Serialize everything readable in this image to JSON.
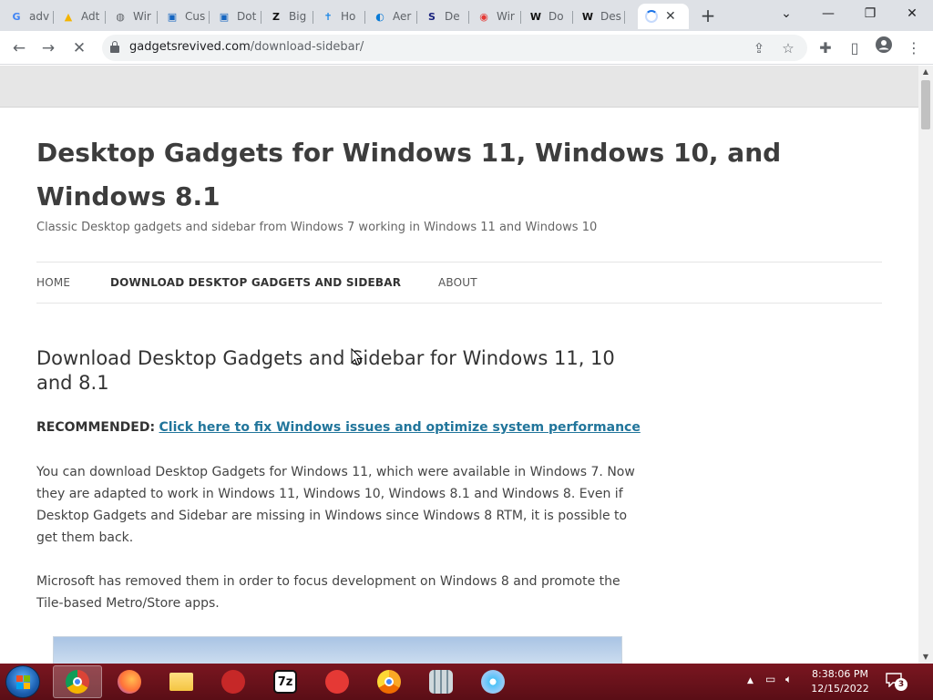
{
  "browser": {
    "tabs": [
      {
        "label": "adv",
        "favicon": "google-icon",
        "color": "#4285f4",
        "glyph": "G"
      },
      {
        "label": "Adt",
        "favicon": "drive-icon",
        "color": "#f4b400",
        "glyph": "▲"
      },
      {
        "label": "Wir",
        "favicon": "globe-icon",
        "color": "#5f6368",
        "glyph": "◍"
      },
      {
        "label": "Cus",
        "favicon": "windows-blog-icon",
        "color": "#1565c0",
        "glyph": "▣"
      },
      {
        "label": "Dot",
        "favicon": "windows-blog-icon",
        "color": "#1565c0",
        "glyph": "▣"
      },
      {
        "label": "Big",
        "favicon": "zenduty-icon",
        "color": "#111111",
        "glyph": "Z"
      },
      {
        "label": "Ho",
        "favicon": "cross-icon",
        "color": "#1e88e5",
        "glyph": "✝"
      },
      {
        "label": "Aer",
        "favicon": "edge-icon",
        "color": "#0a7bd6",
        "glyph": "◐"
      },
      {
        "label": "De",
        "favicon": "s-logo-icon",
        "color": "#1a237e",
        "glyph": "S"
      },
      {
        "label": "Wir",
        "favicon": "disc-icon",
        "color": "#e53935",
        "glyph": "◉"
      },
      {
        "label": "Do",
        "favicon": "w-logo-icon",
        "color": "#111111",
        "glyph": "W"
      },
      {
        "label": "Des",
        "favicon": "w-logo-icon",
        "color": "#111111",
        "glyph": "W"
      }
    ],
    "address": {
      "host": "gadgetsrevived.com",
      "path": "/download-sidebar/"
    }
  },
  "site": {
    "title": "Desktop Gadgets for Windows 11, Windows 10, and Windows 8.1",
    "description": "Classic Desktop gadgets and sidebar from Windows 7 working in Windows 11 and Windows 10",
    "nav": [
      {
        "label": "HOME",
        "current": false
      },
      {
        "label": "DOWNLOAD DESKTOP GADGETS AND SIDEBAR",
        "current": true
      },
      {
        "label": "ABOUT",
        "current": false
      }
    ]
  },
  "article": {
    "title": "Download Desktop Gadgets and Sidebar for Windows 11, 10 and 8.1",
    "recommended_label": "RECOMMENDED:",
    "recommended_link": "Click here to fix Windows issues and optimize system performance",
    "paragraphs": [
      "You can download Desktop Gadgets for Windows 11, which were available in Windows 7. Now they are adapted to work in Windows 11, Windows 10, Windows 8.1 and Windows 8. Even if Desktop Gadgets and Sidebar are missing in Windows since Windows 8 RTM, it is possible to get them back.",
      "Microsoft has removed them in order to focus development on Windows 8 and promote the Tile-based Metro/Store apps."
    ]
  },
  "taskbar": {
    "apps": [
      {
        "name": "chrome",
        "glyph": "",
        "color": "#db4437",
        "active": true
      },
      {
        "name": "firefox",
        "glyph": "",
        "color": "#ff7139",
        "active": false
      },
      {
        "name": "file-explorer",
        "glyph": "",
        "color": "#f4c542",
        "active": false
      },
      {
        "name": "app-red-dots",
        "glyph": "",
        "color": "#c62828",
        "active": false
      },
      {
        "name": "7zip",
        "glyph": "7z",
        "color": "#111111",
        "active": false
      },
      {
        "name": "app-gear",
        "glyph": "",
        "color": "#e53935",
        "active": false
      },
      {
        "name": "chrome-canary",
        "glyph": "",
        "color": "#f9a825",
        "active": false
      },
      {
        "name": "calculator",
        "glyph": "",
        "color": "#90a4ae",
        "active": false
      },
      {
        "name": "dvd-maker",
        "glyph": "",
        "color": "#4fc3f7",
        "active": false
      }
    ],
    "time": "8:38:06 PM",
    "date": "12/15/2022",
    "notification_count": "3"
  }
}
